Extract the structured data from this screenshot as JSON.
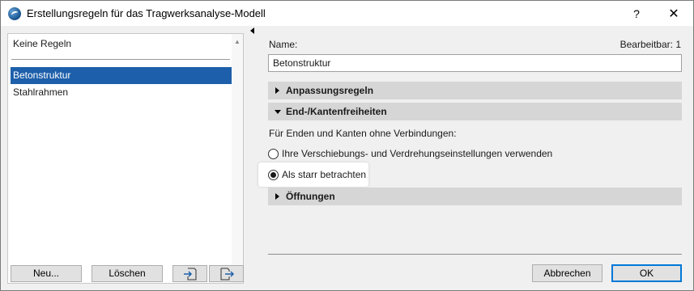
{
  "window": {
    "title": "Erstellungsregeln für das Tragwerksanalyse-Modell",
    "help_label": "?",
    "close_label": "✕"
  },
  "rules_list": {
    "none_item": "Keine Regeln",
    "items": [
      {
        "label": "Betonstruktur",
        "selected": true
      },
      {
        "label": "Stahlrahmen",
        "selected": false
      }
    ]
  },
  "left_buttons": {
    "new_label": "Neu...",
    "delete_label": "Löschen",
    "import_icon": "import-icon",
    "export_icon": "export-icon"
  },
  "details": {
    "name_label": "Name:",
    "editable_label": "Bearbeitbar: 1",
    "name_value": "Betonstruktur",
    "sections": {
      "adjustment_rules": "Anpassungsregeln",
      "end_edge_releases": "End-/Kantenfreiheiten",
      "openings": "Öffnungen"
    },
    "edges_note": "Für Enden und Kanten ohne Verbindungen:",
    "radio_options": [
      {
        "label": "Ihre Verschiebungs- und Verdrehungseinstellungen verwenden",
        "checked": false
      },
      {
        "label": "Als starr betrachten",
        "checked": true
      }
    ]
  },
  "dialog_buttons": {
    "cancel_label": "Abbrechen",
    "ok_label": "OK"
  },
  "colors": {
    "selection": "#1d5faa",
    "section_header": "#d6d6d6",
    "default_button_border": "#0078d7"
  }
}
